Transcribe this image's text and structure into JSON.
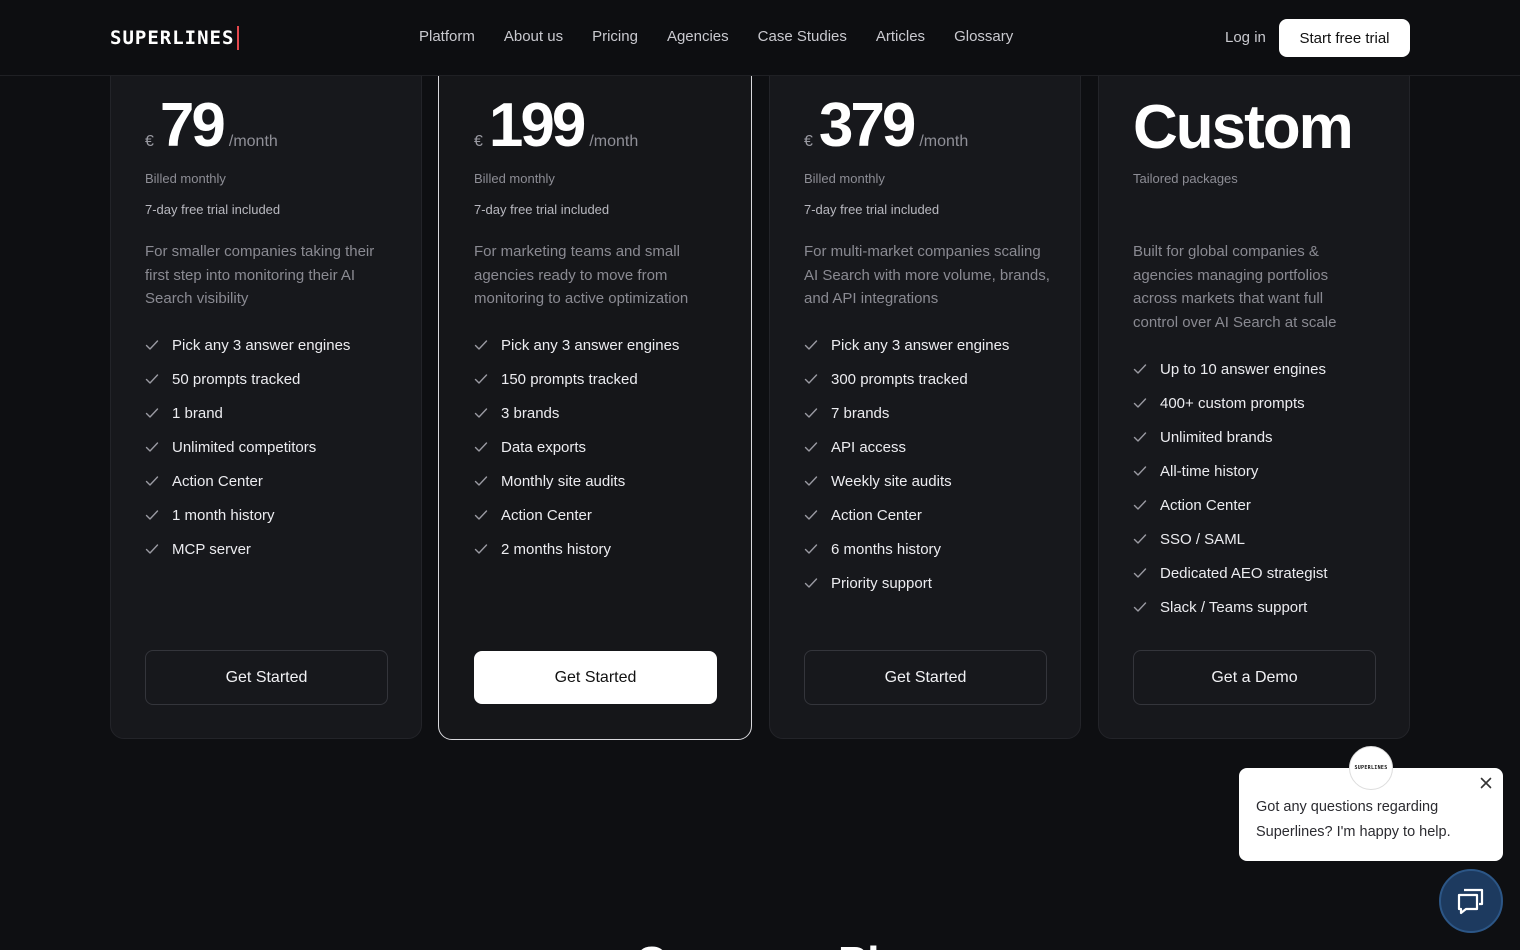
{
  "nav": {
    "logo": "SUPERLINES",
    "links": [
      "Platform",
      "About us",
      "Pricing",
      "Agencies",
      "Case Studies",
      "Articles",
      "Glossary"
    ],
    "login": "Log in",
    "cta": "Start free trial"
  },
  "plans": [
    {
      "currency": "€",
      "price": "79",
      "period": "/month",
      "billing": "Billed monthly",
      "trial": "7-day free trial included",
      "description": "For smaller companies taking their first step into monitoring their AI Search visibility",
      "features": [
        "Pick any 3 answer engines",
        "50 prompts tracked",
        "1 brand",
        "Unlimited competitors",
        "Action Center",
        "1 month history",
        "MCP server"
      ],
      "cta": "Get Started"
    },
    {
      "currency": "€",
      "price": "199",
      "period": "/month",
      "billing": "Billed monthly",
      "trial": "7-day free trial included",
      "description": "For marketing teams and small agencies ready to move from monitoring to active optimization",
      "features": [
        "Pick any 3 answer engines",
        "150 prompts tracked",
        "3 brands",
        "Data exports",
        "Monthly site audits",
        "Action Center",
        "2 months history"
      ],
      "cta": "Get Started"
    },
    {
      "currency": "€",
      "price": "379",
      "period": "/month",
      "billing": "Billed monthly",
      "trial": "7-day free trial included",
      "description": "For multi-market companies scaling AI Search with more volume, brands, and API integrations",
      "features": [
        "Pick any 3 answer engines",
        "300 prompts tracked",
        "7 brands",
        "API access",
        "Weekly site audits",
        "Action Center",
        "6 months history",
        "Priority support"
      ],
      "cta": "Get Started"
    },
    {
      "title": "Custom",
      "billing": "Tailored packages",
      "description": "Built for global companies & agencies managing portfolios across markets that want full control over AI Search at scale",
      "features": [
        "Up to 10 answer engines",
        "400+ custom prompts",
        "Unlimited brands",
        "All-time history",
        "Action Center",
        "SSO / SAML",
        "Dedicated AEO strategist",
        "Slack / Teams support"
      ],
      "cta": "Get a Demo"
    }
  ],
  "chat": {
    "avatar_text": "SUPERLINES",
    "message": "Got any questions regarding Superlines? I'm happy to help.",
    "close_icon": "close-icon",
    "launcher_icon": "chat-bubbles-icon"
  },
  "bottom_heading": "Compare Pl",
  "colors": {
    "background": "#0e0f12",
    "card": "#17181c",
    "accent_logo_bar": "#e5484d",
    "chat_launcher": "#1d3a5f"
  }
}
